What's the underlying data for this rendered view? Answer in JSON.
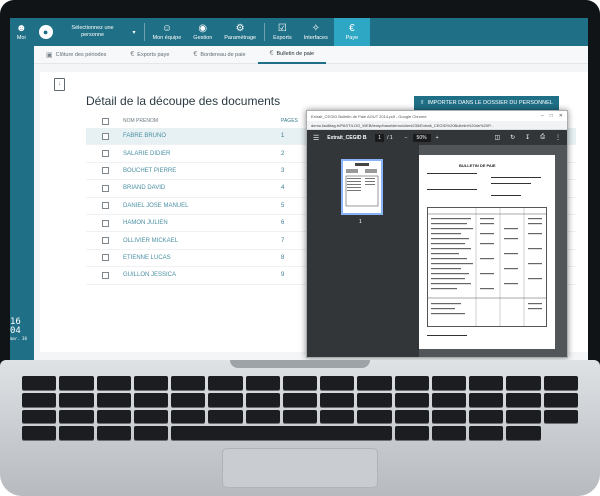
{
  "nav": {
    "items": [
      {
        "icon": "person-icon",
        "label": "Moi"
      },
      {
        "icon": "team-icon",
        "label": "Mon équipe"
      },
      {
        "icon": "globe-icon",
        "label": "Gestion"
      },
      {
        "icon": "gear-icon",
        "label": "Paramétrage"
      },
      {
        "icon": "export-icon",
        "label": "Exports"
      },
      {
        "icon": "puzzle-icon",
        "label": "Interfaces"
      },
      {
        "icon": "euro-icon",
        "label": "Paye"
      }
    ],
    "person_select": "Sélectionnez une personne",
    "accent": "#1f6f86",
    "active_color": "#2ea7c4"
  },
  "side_clock": {
    "big": "16 04",
    "small": "mar. 30"
  },
  "subtabs": [
    {
      "label": "Clôture des périodes"
    },
    {
      "label": "Exports paye"
    },
    {
      "label": "Bordereau de paie"
    },
    {
      "label": "Bulletin de paie"
    }
  ],
  "main": {
    "title": "Détail de la découpe des documents",
    "import_button": "IMPORTER DANS LE DOSSIER DU PERSONNEL",
    "columns": {
      "name": "NOM PRENOM",
      "pages": "PAGES"
    },
    "rows": [
      {
        "name": "FABRE BRUNO",
        "pages": "1"
      },
      {
        "name": "SALARIE DIDIER",
        "pages": "2"
      },
      {
        "name": "BOUCHET PIERRE",
        "pages": "3"
      },
      {
        "name": "BRIAND DAVID",
        "pages": "4"
      },
      {
        "name": "DANIEL JOSE MANUEL",
        "pages": "5"
      },
      {
        "name": "HAMON JULIEN",
        "pages": "6"
      },
      {
        "name": "OLLIVIER MICKAEL",
        "pages": "7"
      },
      {
        "name": "ETIENNE LUCAS",
        "pages": "8"
      },
      {
        "name": "GUILLON JESSICA",
        "pages": "9"
      }
    ]
  },
  "pdf": {
    "window_title": "Extrait_CEGID Bulletin de Paie AOUT 2014.pdf - Google Chrome",
    "url": "demo.facilitag.fr/PASTILOG_WEB/temp/baseidemo/client235/Extrait_CEGID%20Bulletin%20de%20P...",
    "file_name": "Extrait_CEGID B...",
    "page_current": "1",
    "page_total": "/ 1",
    "zoom": "50%",
    "thumb_number": "1",
    "sheet_title": "BULLETIN DE PAIE"
  }
}
